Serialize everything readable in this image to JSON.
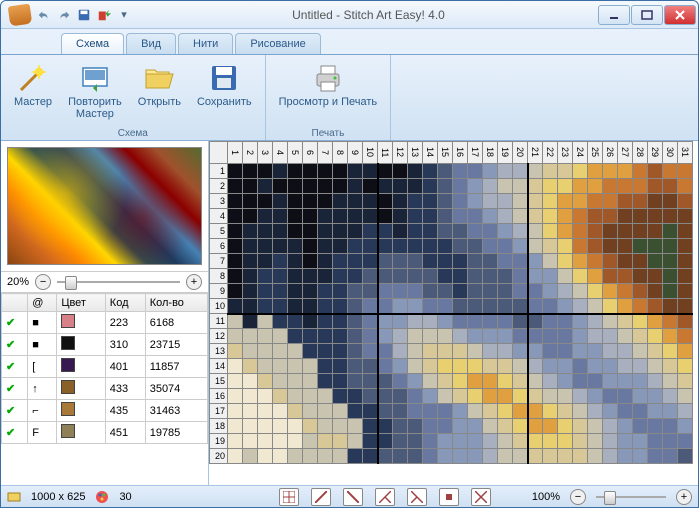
{
  "window": {
    "title": "Untitled - Stitch Art Easy! 4.0"
  },
  "tabs": [
    {
      "label": "Схема",
      "active": true
    },
    {
      "label": "Вид"
    },
    {
      "label": "Нити"
    },
    {
      "label": "Рисование"
    }
  ],
  "ribbon": {
    "group1": {
      "title": "Схема",
      "buttons": [
        {
          "label": "Мастер",
          "icon": "wand"
        },
        {
          "label": "Повторить\nМастер",
          "icon": "repeat-wizard"
        },
        {
          "label": "Открыть",
          "icon": "folder"
        },
        {
          "label": "Сохранить",
          "icon": "floppy"
        }
      ]
    },
    "group2": {
      "title": "Печать",
      "buttons": [
        {
          "label": "Просмотр и Печать",
          "icon": "printer"
        }
      ]
    }
  },
  "zoom": {
    "percent": "20%"
  },
  "colortable": {
    "headers": [
      "",
      "@",
      "Цвет",
      "Код",
      "Кол-во"
    ],
    "rows": [
      {
        "symbol": "■",
        "color": "#d88088",
        "code": "223",
        "count": "6168"
      },
      {
        "symbol": "■",
        "color": "#101010",
        "code": "310",
        "count": "23715"
      },
      {
        "symbol": "[",
        "color": "#381850",
        "code": "401",
        "count": "11857"
      },
      {
        "symbol": "↑",
        "color": "#886028",
        "code": "433",
        "count": "35074"
      },
      {
        "symbol": "⌐",
        "color": "#a87838",
        "code": "435",
        "count": "31463"
      },
      {
        "symbol": "F",
        "color": "#908058",
        "code": "451",
        "count": "19785"
      }
    ]
  },
  "status": {
    "dimensions": "1000 x 625",
    "colors": "30",
    "zoom": "100%"
  },
  "grid": {
    "cols": [
      1,
      2,
      3,
      4,
      5,
      6,
      7,
      8,
      9,
      10,
      11,
      12,
      13,
      14,
      15,
      16,
      17,
      18,
      19,
      20,
      21,
      22,
      23,
      24,
      25,
      26,
      27,
      28,
      29,
      30,
      31
    ],
    "rows": [
      1,
      2,
      3,
      4,
      5,
      6,
      7,
      8,
      9,
      10,
      11,
      12,
      13,
      14,
      15,
      16,
      17,
      18,
      19,
      20
    ],
    "palette": {
      "a": "#0e0e16",
      "b": "#1a2438",
      "c": "#283858",
      "d": "#4a5a78",
      "e": "#6878a0",
      "f": "#8898b8",
      "g": "#a8b0c0",
      "h": "#c8c4b0",
      "i": "#d8c898",
      "j": "#e8d070",
      "k": "#e0a040",
      "l": "#c87830",
      "m": "#a05828",
      "n": "#704020",
      "o": "#3a5030",
      "p": "#587040",
      "q": "#789050",
      "r": "#98a868",
      "s": "#a03030",
      "t": "#c05050",
      "u": "#702838",
      "v": "#f0e8d0",
      "w": "#909898"
    },
    "cells": [
      "aaabaaaabbaabcdeefgghiijkkklmll",
      "aabaaaaababbbcdefghhijjkklllmml",
      "aaabaaabbbabccdefgghijkkllmmnnm",
      "aabbaabbbbabccdeefghijklmmnnnnn",
      "abbbaabbbccbccddeefghjklmnnnnon",
      "abbbbabbcccccccddeefhijlmnnooon",
      "abbcbabcccdddcccddeefhjklmnnoon",
      "abccbbbccdddddccdddeffhjkmmnnon",
      "abccbbccddeeeddcdddeefghjklmnon",
      "bbccbbccdeeffeedddddeefghjklmnn",
      "hbhccbccdeffggfeeeeddeefghijklm",
      "hhhhccccdefghhhgfffeeeefgghijkl",
      "ihhhhcccdeeghiiihggffeeffgghijk",
      "vihhhhccddefhijjjiihgffeffgghij",
      "vvihhhccdddefhijkkjihgfeefffghi",
      "vvvihhhccdddefhijkkjihhgfeeffgh",
      "vvvvihhhccddeeefhijkkjihgfeeffg",
      "vvvvvihhhccddeeffhijkkjihgfeeef",
      "vvvvvhiihccddefffghijjjihgffeee",
      "vhvvhhhhccdddefffghhiiiihgffeed"
    ]
  }
}
